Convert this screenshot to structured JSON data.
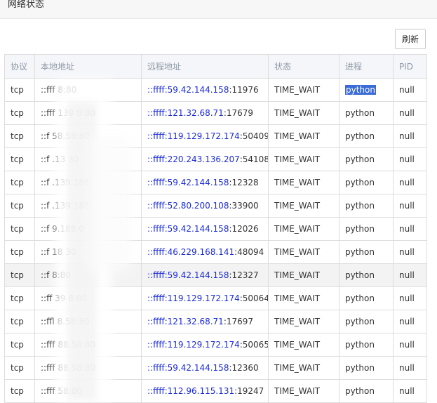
{
  "panel": {
    "title": "网络状态"
  },
  "toolbar": {
    "refresh_label": "刷新"
  },
  "table": {
    "headers": [
      "协议",
      "本地地址",
      "远程地址",
      "状态",
      "进程",
      "PID"
    ],
    "rows": [
      {
        "proto": "tcp",
        "local": "::fff          8:80",
        "remote_ip": "::ffff:59.42.144.158",
        "remote_port": ":11976",
        "state": "TIME_WAIT",
        "proc": "python",
        "pid": "null"
      },
      {
        "proto": "tcp",
        "local": "::fff      139    8:80",
        "remote_ip": "::ffff:121.32.68.71",
        "remote_port": ":17679",
        "state": "TIME_WAIT",
        "proc": "python",
        "pid": "null"
      },
      {
        "proto": "tcp",
        "local": "::f          58.58:80",
        "remote_ip": "::ffff:119.129.172.174",
        "remote_port": ":50409",
        "state": "TIME_WAIT",
        "proc": "python",
        "pid": "null"
      },
      {
        "proto": "tcp",
        "local": "::f        .13      30",
        "remote_ip": "::ffff:220.243.136.207",
        "remote_port": ":54108",
        "state": "TIME_WAIT",
        "proc": "python",
        "pid": "null"
      },
      {
        "proto": "tcp",
        "local": "::f     .139.188.",
        "remote_ip": "::ffff:59.42.144.158",
        "remote_port": ":12328",
        "state": "TIME_WAIT",
        "proc": "python",
        "pid": "null"
      },
      {
        "proto": "tcp",
        "local": "::f     .139.188.",
        "remote_ip": "::ffff:52.80.200.108",
        "remote_port": ":33900",
        "state": "TIME_WAIT",
        "proc": "python",
        "pid": "null"
      },
      {
        "proto": "tcp",
        "local": "::f          9.188      0",
        "remote_ip": "::ffff:59.42.144.158",
        "remote_port": ":12026",
        "state": "TIME_WAIT",
        "proc": "python",
        "pid": "null"
      },
      {
        "proto": "tcp",
        "local": "::f          18      30",
        "remote_ip": "::ffff:46.229.168.141",
        "remote_port": ":48094",
        "state": "TIME_WAIT",
        "proc": "python",
        "pid": "null"
      },
      {
        "proto": "tcp",
        "local": "::f              8:80",
        "remote_ip": "::ffff:59.42.144.158",
        "remote_port": ":12327",
        "state": "TIME_WAIT",
        "proc": "python",
        "pid": "null"
      },
      {
        "proto": "tcp",
        "local": "::ff        39    8:80",
        "remote_ip": "::ffff:119.129.172.174",
        "remote_port": ":50064",
        "state": "TIME_WAIT",
        "proc": "python",
        "pid": "null"
      },
      {
        "proto": "tcp",
        "local": "::ffl          8.58:80",
        "remote_ip": "::ffff:121.32.68.71",
        "remote_port": ":17697",
        "state": "TIME_WAIT",
        "proc": "python",
        "pid": "null"
      },
      {
        "proto": "tcp",
        "local": "::fff        88.58:80",
        "remote_ip": "::ffff:119.129.172.174",
        "remote_port": ":50065",
        "state": "TIME_WAIT",
        "proc": "python",
        "pid": "null"
      },
      {
        "proto": "tcp",
        "local": "::fff        88.58:80",
        "remote_ip": "::ffff:59.42.144.158",
        "remote_port": ":12360",
        "state": "TIME_WAIT",
        "proc": "python",
        "pid": "null"
      },
      {
        "proto": "tcp",
        "local": "::fff          58:80",
        "remote_ip": "::ffff:112.96.115.131",
        "remote_port": ":19247",
        "state": "TIME_WAIT",
        "proc": "python",
        "pid": "null"
      }
    ]
  },
  "colors": {
    "ip_text": "#1b2bd6",
    "selection": "#3b6cd6",
    "header_bg": "#f5f6fa",
    "border": "#dddddd"
  }
}
